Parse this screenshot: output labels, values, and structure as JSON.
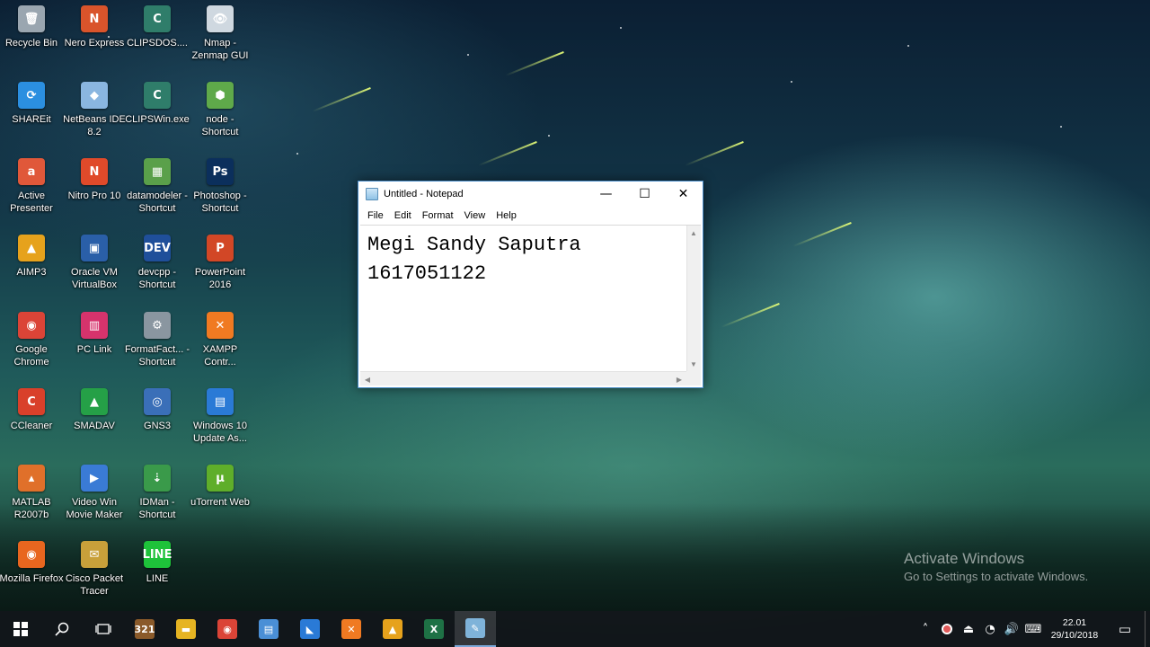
{
  "desktop": {
    "icons": [
      {
        "label": "Recycle Bin",
        "glyph": "🗑",
        "color": "#9aa6b0"
      },
      {
        "label": "Nero Express",
        "glyph": "N",
        "color": "#d9542b"
      },
      {
        "label": "CLIPSDOS....",
        "glyph": "C",
        "color": "#2f7d6a"
      },
      {
        "label": "Nmap - Zenmap GUI",
        "glyph": "👁",
        "color": "#cfd8e0"
      },
      {
        "label": "SHAREit",
        "glyph": "⟳",
        "color": "#2b8fe0"
      },
      {
        "label": "NetBeans IDE 8.2",
        "glyph": "◆",
        "color": "#8ab6e0"
      },
      {
        "label": "CLIPSWin.exe",
        "glyph": "C",
        "color": "#2f7d6a"
      },
      {
        "label": "node - Shortcut",
        "glyph": "⬢",
        "color": "#5fa94a"
      },
      {
        "label": "Active Presenter",
        "glyph": "a",
        "color": "#e0583a"
      },
      {
        "label": "Nitro Pro 10",
        "glyph": "N",
        "color": "#e04a2a"
      },
      {
        "label": "datamodeler - Shortcut",
        "glyph": "▦",
        "color": "#5aa04a"
      },
      {
        "label": "Photoshop - Shortcut",
        "glyph": "Ps",
        "color": "#0b2f5c"
      },
      {
        "label": "AIMP3",
        "glyph": "▲",
        "color": "#e6a21c"
      },
      {
        "label": "Oracle VM VirtualBox",
        "glyph": "▣",
        "color": "#2a5fa8"
      },
      {
        "label": "devcpp - Shortcut",
        "glyph": "DEV",
        "color": "#1f4f9a"
      },
      {
        "label": "PowerPoint 2016",
        "glyph": "P",
        "color": "#d24726"
      },
      {
        "label": "Google Chrome",
        "glyph": "◉",
        "color": "#db4437"
      },
      {
        "label": "PC Link",
        "glyph": "▥",
        "color": "#d6336c"
      },
      {
        "label": "FormatFact... - Shortcut",
        "glyph": "⚙",
        "color": "#8a96a0"
      },
      {
        "label": "XAMPP Contr...",
        "glyph": "✕",
        "color": "#f07a22"
      },
      {
        "label": "CCleaner",
        "glyph": "C",
        "color": "#d9402a"
      },
      {
        "label": "SMADAV",
        "glyph": "▲",
        "color": "#25a047"
      },
      {
        "label": "GNS3",
        "glyph": "◎",
        "color": "#3a6fb8"
      },
      {
        "label": "Windows 10 Update As...",
        "glyph": "▤",
        "color": "#2a7ad6"
      },
      {
        "label": "MATLAB R2007b",
        "glyph": "▴",
        "color": "#e0702a"
      },
      {
        "label": "Video Win Movie Maker",
        "glyph": "▶",
        "color": "#3a7bd5"
      },
      {
        "label": "IDMan - Shortcut",
        "glyph": "⇣",
        "color": "#3a9a4a"
      },
      {
        "label": "uTorrent Web",
        "glyph": "µ",
        "color": "#5fae2a"
      },
      {
        "label": "Mozilla Firefox",
        "glyph": "◉",
        "color": "#e8661f"
      },
      {
        "label": "Cisco Packet Tracer",
        "glyph": "✉",
        "color": "#c8a03a"
      },
      {
        "label": "LINE",
        "glyph": "LINE",
        "color": "#1ec23a"
      }
    ]
  },
  "notepad": {
    "title": "Untitled - Notepad",
    "menu": [
      "File",
      "Edit",
      "Format",
      "View",
      "Help"
    ],
    "content": "Megi Sandy Saputra\n1617051122",
    "minimize": "—",
    "maximize": "☐",
    "close": "✕"
  },
  "watermark": {
    "title": "Activate Windows",
    "subtitle": "Go to Settings to activate Windows."
  },
  "taskbar": {
    "start_icon": "windows-logo",
    "apps": [
      {
        "name": "calendar-app",
        "label": "321",
        "color": "#8a5a2a"
      },
      {
        "name": "file-explorer",
        "label": "▬",
        "color": "#e6b422"
      },
      {
        "name": "google-chrome",
        "label": "◉",
        "color": "#db4437"
      },
      {
        "name": "control-panel",
        "label": "▤",
        "color": "#4a8fd6"
      },
      {
        "name": "visual-studio-code",
        "label": "◣",
        "color": "#2a7ad6"
      },
      {
        "name": "xampp",
        "label": "✕",
        "color": "#f07a22"
      },
      {
        "name": "aimp",
        "label": "▲",
        "color": "#e6a21c"
      },
      {
        "name": "excel",
        "label": "X",
        "color": "#1e7145"
      },
      {
        "name": "notepad",
        "label": "✎",
        "color": "#7fb3d9",
        "active": true
      }
    ],
    "clock_time": "22.01",
    "clock_date": "29/10/2018"
  }
}
